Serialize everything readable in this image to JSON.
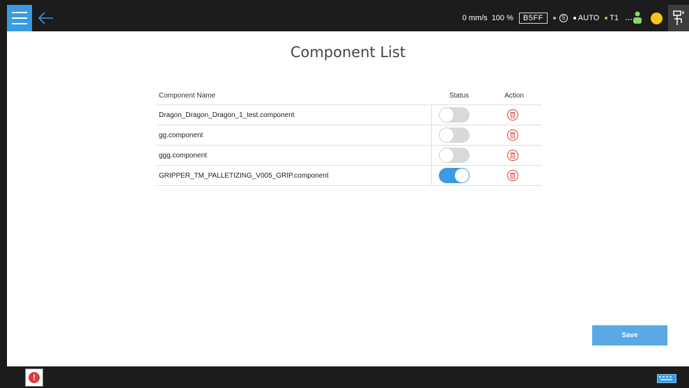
{
  "header": {
    "speed": "0 mm/s",
    "percent": "100 %",
    "code": "B5FF",
    "mode": "AUTO",
    "tool": "T1"
  },
  "page": {
    "title": "Component List"
  },
  "table": {
    "headers": {
      "name": "Component Name",
      "status": "Status",
      "action": "Action"
    },
    "rows": [
      {
        "name": "Dragon_Dragon_Dragon_1_test.component",
        "enabled": false
      },
      {
        "name": "gg.component",
        "enabled": false
      },
      {
        "name": "ggg.component",
        "enabled": false
      },
      {
        "name": "GRIPPER_TM_PALLETIZING_V005_GRIP.component",
        "enabled": true
      }
    ]
  },
  "actions": {
    "save_label": "Save"
  },
  "icons": {
    "menu": "hamburger-menu-icon",
    "back": "back-arrow-icon",
    "safety": "safety-s-icon",
    "robot": "robot-status-icon",
    "light": "status-light-icon",
    "lock": "end-button-lock-icon",
    "delete": "trash-icon",
    "alarm": "alarm-icon",
    "keyboard": "keyboard-icon"
  },
  "colors": {
    "accent": "#3a9be0",
    "bar": "#1c1c1c",
    "delete": "#e05a50",
    "status_green": "#8ad66b",
    "status_yellow": "#f4c51c"
  }
}
